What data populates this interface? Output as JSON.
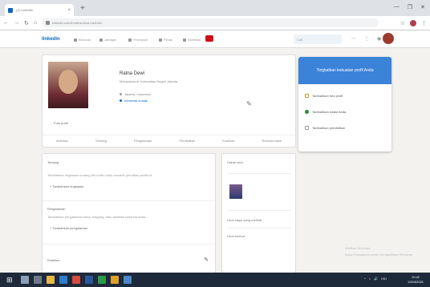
{
  "browser": {
    "tab_title": "(3) LinkedIn",
    "new_tab_glyph": "+",
    "controls": [
      "—",
      "❐",
      "✕"
    ],
    "url": "linkedin.com/in/ratna-dewi-1a2b3c/",
    "nav_glyphs": [
      "←",
      "→",
      "↻",
      "⌂"
    ],
    "toolbar_right": [
      "☆",
      "⋮"
    ]
  },
  "linkedin_nav": {
    "logo": "linkedin",
    "items": [
      "Beranda",
      "Jaringan",
      "Pekerjaan",
      "Pesan",
      "Notifikasi"
    ],
    "search_placeholder": "Cari",
    "icons": [
      "⋯",
      "⋮",
      "◉"
    ]
  },
  "profile": {
    "name": "Ratna Dewi",
    "headline": "Mahasiswa di Universitas Negeri Jakarta",
    "location": "Jakarta, Indonesia",
    "link": "Informasi kontak",
    "photo_caption": "Foto profil",
    "tabs": [
      "Aktivitas",
      "Tentang",
      "Pengalaman",
      "Pendidikan",
      "Keahlian",
      "Rekomendasi"
    ]
  },
  "sections": {
    "heading_1": "Tentang",
    "text_1": "Tambahkan ringkasan tentang diri Anda untuk menarik perhatian perekrut.",
    "add_1": "+ Tambahkan ringkasan",
    "heading_2": "Pengalaman",
    "text_2": "Tambahkan pengalaman kerja, magang, atau aktivitas sukarela Anda.",
    "add_2": "+ Tambahkan pengalaman",
    "heading_3": "Keahlian"
  },
  "right_card": {
    "title": "Dilihat oleh",
    "item_1": "Lihat siapa yang melihat",
    "item_2": "Lihat semua"
  },
  "panel": {
    "title": "Tingkatkan kekuatan profil Anda",
    "items": [
      "Tambahkan foto profil",
      "Tambahkan lokasi Anda",
      "Tambahkan pendidikan"
    ]
  },
  "watermark": [
    "Aktifkan Windows",
    "Buka Pengaturan untuk mengaktifkan Windows"
  ],
  "taskbar": {
    "start_glyph": "⊞",
    "tray": [
      "^",
      "⌂",
      "🔊",
      "IND"
    ],
    "time": "10.42",
    "date": "12/03/2021"
  },
  "colors": {
    "brand": "#0a66c2",
    "panel_header": "#3b82d9",
    "taskbar": "#1e2a3a"
  }
}
